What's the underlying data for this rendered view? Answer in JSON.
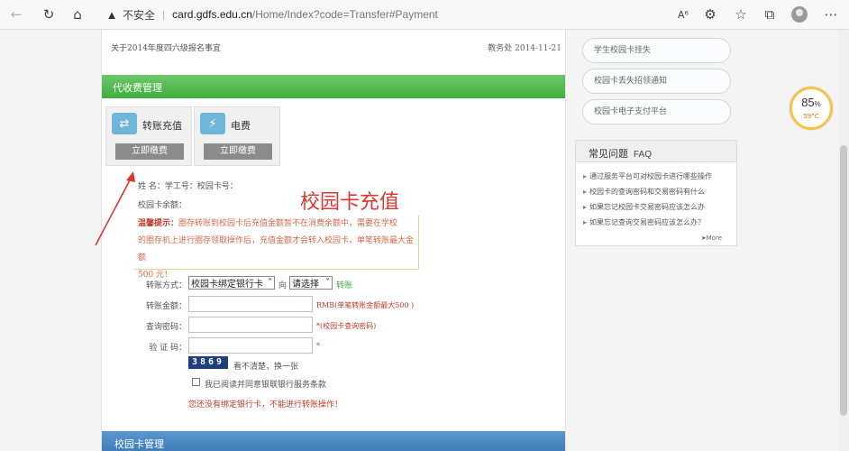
{
  "browser": {
    "insecure_label": "不安全",
    "url_host": "card.gdfs.edu.cn",
    "url_path": "/Home/Index?code=Transfer#Payment"
  },
  "news": {
    "item": "关于2014年度四六级报名事宜",
    "dept_date": "教务处  2014-11-21"
  },
  "section_title": "代收费管理",
  "services": [
    {
      "label": "转账充值",
      "button": "立即缴费"
    },
    {
      "label": "电费",
      "button": "立即缴费"
    }
  ],
  "user_line": "姓          名：学工号：校园卡号：",
  "balance_label": "校园卡余额：",
  "page_title": "校园卡充值",
  "notice": {
    "head": "温馨提示：",
    "text1": "圈存转账到校园卡后充值金额暂不在消费余额中，需要在学校",
    "text2": "的圈存机上进行圈存领取操作后，充值金额才会转入校园卡，单笔转账最大金额",
    "text3": "500 元！"
  },
  "form": {
    "method_label": "转账方式：",
    "method_value": "校园卡绑定银行卡",
    "to_label": "向",
    "target_value": "请选择",
    "transfer_label": "转账",
    "amount_label": "转账金额：",
    "amount_hint": "RMB(单笔转账金额最大500 )",
    "password_label": "查询密码：",
    "password_hint": "*(校园卡查询密码)",
    "code_label": "验  证  码：",
    "code_hint": "*",
    "captcha": "3869",
    "captcha_hint": "看不清楚，换一张",
    "agree_label": "我已阅读并同意银联银行服务条款",
    "bind_warning": "您还没有绑定银行卡，不能进行转账操作！"
  },
  "footer_section": "校园卡管理",
  "right_links": [
    "学生校园卡挂失",
    "校园卡丢失招领通知",
    "校园卡电子支付平台"
  ],
  "faq": {
    "title": "常见问题",
    "title_en": "FAQ",
    "items": [
      "通过服务平台可对校园卡进行哪些操作",
      "校园卡的查询密码和交易密码有什么",
      "如果忘记校园卡交易密码应该怎么办",
      "如果忘记查询交易密码应该怎么办？"
    ],
    "more": "More"
  },
  "widget": {
    "percent": "85",
    "percent_unit": "%",
    "temp": "59°C"
  },
  "colors": {
    "green": "#3fae3d",
    "blue": "#3d79b8",
    "red": "#d9392f"
  }
}
